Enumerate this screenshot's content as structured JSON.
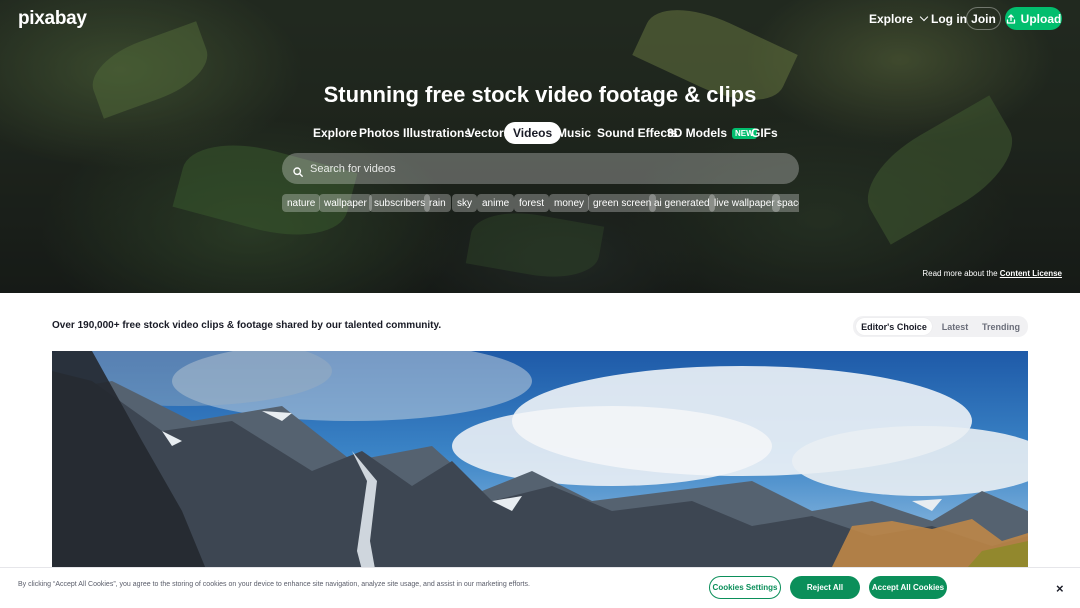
{
  "header": {
    "logo": "pixabay",
    "explore_label": "Explore",
    "login_label": "Log in",
    "join_label": "Join",
    "upload_label": "Upload"
  },
  "hero": {
    "title": "Stunning free stock video footage & clips",
    "tabs": [
      {
        "label": "Explore"
      },
      {
        "label": "Photos"
      },
      {
        "label": "Illustrations"
      },
      {
        "label": "Vectors"
      },
      {
        "label": "Videos",
        "active": true
      },
      {
        "label": "Music"
      },
      {
        "label": "Sound Effects"
      },
      {
        "label": "3D Models",
        "badge": "NEW"
      },
      {
        "label": "GIFs"
      }
    ],
    "search_placeholder": "Search for videos",
    "tags": [
      "nature",
      "wallpaper",
      "subscribers",
      "rain",
      "sky",
      "anime",
      "forest",
      "money",
      "green screen",
      "ai generated",
      "live wallpaper",
      "space"
    ],
    "license_text": "Read more about the",
    "license_link": "Content License"
  },
  "content": {
    "count_text": "Over 190,000+ free stock video clips & footage shared by our talented community.",
    "sort_options": [
      "Editor's Choice",
      "Latest",
      "Trending"
    ],
    "sort_selected": "Editor's Choice"
  },
  "cookie": {
    "text": "By clicking “Accept All Cookies”, you agree to the storing of cookies on your device to enhance site navigation, analyze site usage, and assist in our marketing efforts.",
    "settings_label": "Cookies Settings",
    "reject_label": "Reject All",
    "accept_label": "Accept All Cookies",
    "close_label": "×"
  },
  "colors": {
    "accent": "#02be6e",
    "cookie_button": "#0b8f5a",
    "text_dark": "#191b26"
  }
}
